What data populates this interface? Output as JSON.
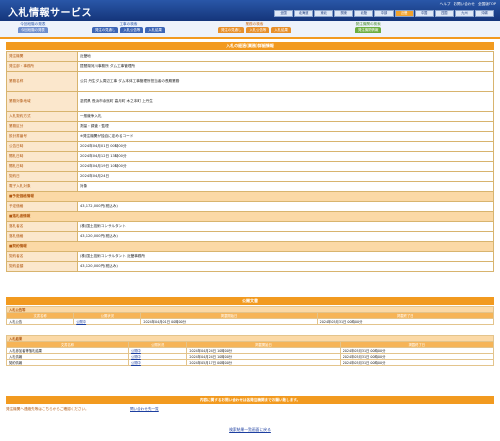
{
  "header": {
    "logo": "入札情報サービス",
    "links": [
      "ヘルプ",
      "お問い合わせ",
      "全国版TOP"
    ],
    "regions": [
      "全国",
      "北海道",
      "東北",
      "関東",
      "北陸",
      "中部",
      "近畿",
      "中国",
      "四国",
      "九州",
      "沖縄"
    ],
    "selected_region": "近畿"
  },
  "search": {
    "groups": [
      {
        "title": "今回段階の発表",
        "tabs": [
          "今回段階の発表"
        ]
      },
      {
        "title": "工事の検索",
        "tabs": [
          "発注の見通し",
          "入札公告等",
          "入札結果"
        ]
      },
      {
        "title": "業務の検索",
        "tabs": [
          "発注の見通し",
          "入札公告等",
          "入札結果"
        ]
      },
      {
        "title": "発注機関の検索",
        "tabs": [
          "発注機関情報"
        ]
      }
    ]
  },
  "detail": {
    "section_title": "入札の経過(業務)詳細情報",
    "rows": [
      {
        "label": "発注機関",
        "value": "近畿地"
      },
      {
        "label": "発注部・事務所",
        "value": "琵琶湖河川事務所 ダム工事管理所"
      },
      {
        "label": "業務名称",
        "value": "公共 丹生ダム周辺工事 ダム本体工事管理所担当者の長期業務"
      },
      {
        "label": "業務対象地域",
        "value": "滋賀県 長浜市余呉町 高月町 木之本町 上丹生"
      },
      {
        "label": "入札契約方式",
        "value": "一般競争入札"
      },
      {
        "label": "業務区分",
        "value": "測量・調査・監理"
      },
      {
        "label": "設計書番号",
        "value": "※発注機関が独自に定めるコード"
      },
      {
        "label": "公告日時",
        "value": "2024年04月01日 00時00分"
      },
      {
        "label": "開札日時",
        "value": "2024年04月12日 13時00分"
      },
      {
        "label": "開札日時",
        "value": "2024年04月19日 10時00分"
      },
      {
        "label": "契約日",
        "value": "2024年04月24日"
      },
      {
        "label": "電子入札対象",
        "value": "対象"
      }
    ],
    "sub_predicted": "■予定価格情報",
    "predicted_label": "予定価格",
    "predicted_value": "43,172,000円(税込み)",
    "sub_winner": "■落札者情報",
    "winner_name_label": "落札者名",
    "winner_name": "(株)国土技術コンサルタント",
    "winner_price_label": "落札価格",
    "winner_price": "43,120,000円(税込み)",
    "sub_contract": "■契約情報",
    "contract_party_label": "契約者名",
    "contract_party": "(株)国土技術コンサルタント 近畿事務所",
    "contract_amount_label": "契約金額",
    "contract_amount": "43,120,000円(税込み)"
  },
  "files": {
    "title": "公開文書",
    "headers": [
      "文書名称",
      "公開状況",
      "掲載開始日",
      "掲載終了日"
    ],
    "notice_category": "入札公告等",
    "notice_rows": [
      {
        "name": "入札公告",
        "status": "公開中",
        "start": "2024年04月01日 00時00分",
        "end": "2024年05月31日 00時00分"
      }
    ],
    "result_category": "入札結果",
    "result_rows": [
      {
        "name": "入札参加者等落札結果",
        "status": "公開中",
        "start": "2024年04月24日 10時00分",
        "end": "2024年05月31日 00時00分"
      },
      {
        "name": "入札情報",
        "status": "公開中",
        "start": "2024年04月24日 10時00分",
        "end": "2024年05月31日 00時00分"
      },
      {
        "name": "契約情報",
        "status": "公開中",
        "start": "2024年05月17日 00時00分",
        "end": "2024年05月31日 00時00分"
      }
    ]
  },
  "contact": {
    "bar": "内容に関するお問い合わせは各発注機関までお願い致します。",
    "text": "発注機関へ連絡先等はこちらからご確認ください。",
    "link": "問い合わせ先一覧"
  },
  "footer": {
    "link": "検索結果一覧画面に戻る"
  }
}
